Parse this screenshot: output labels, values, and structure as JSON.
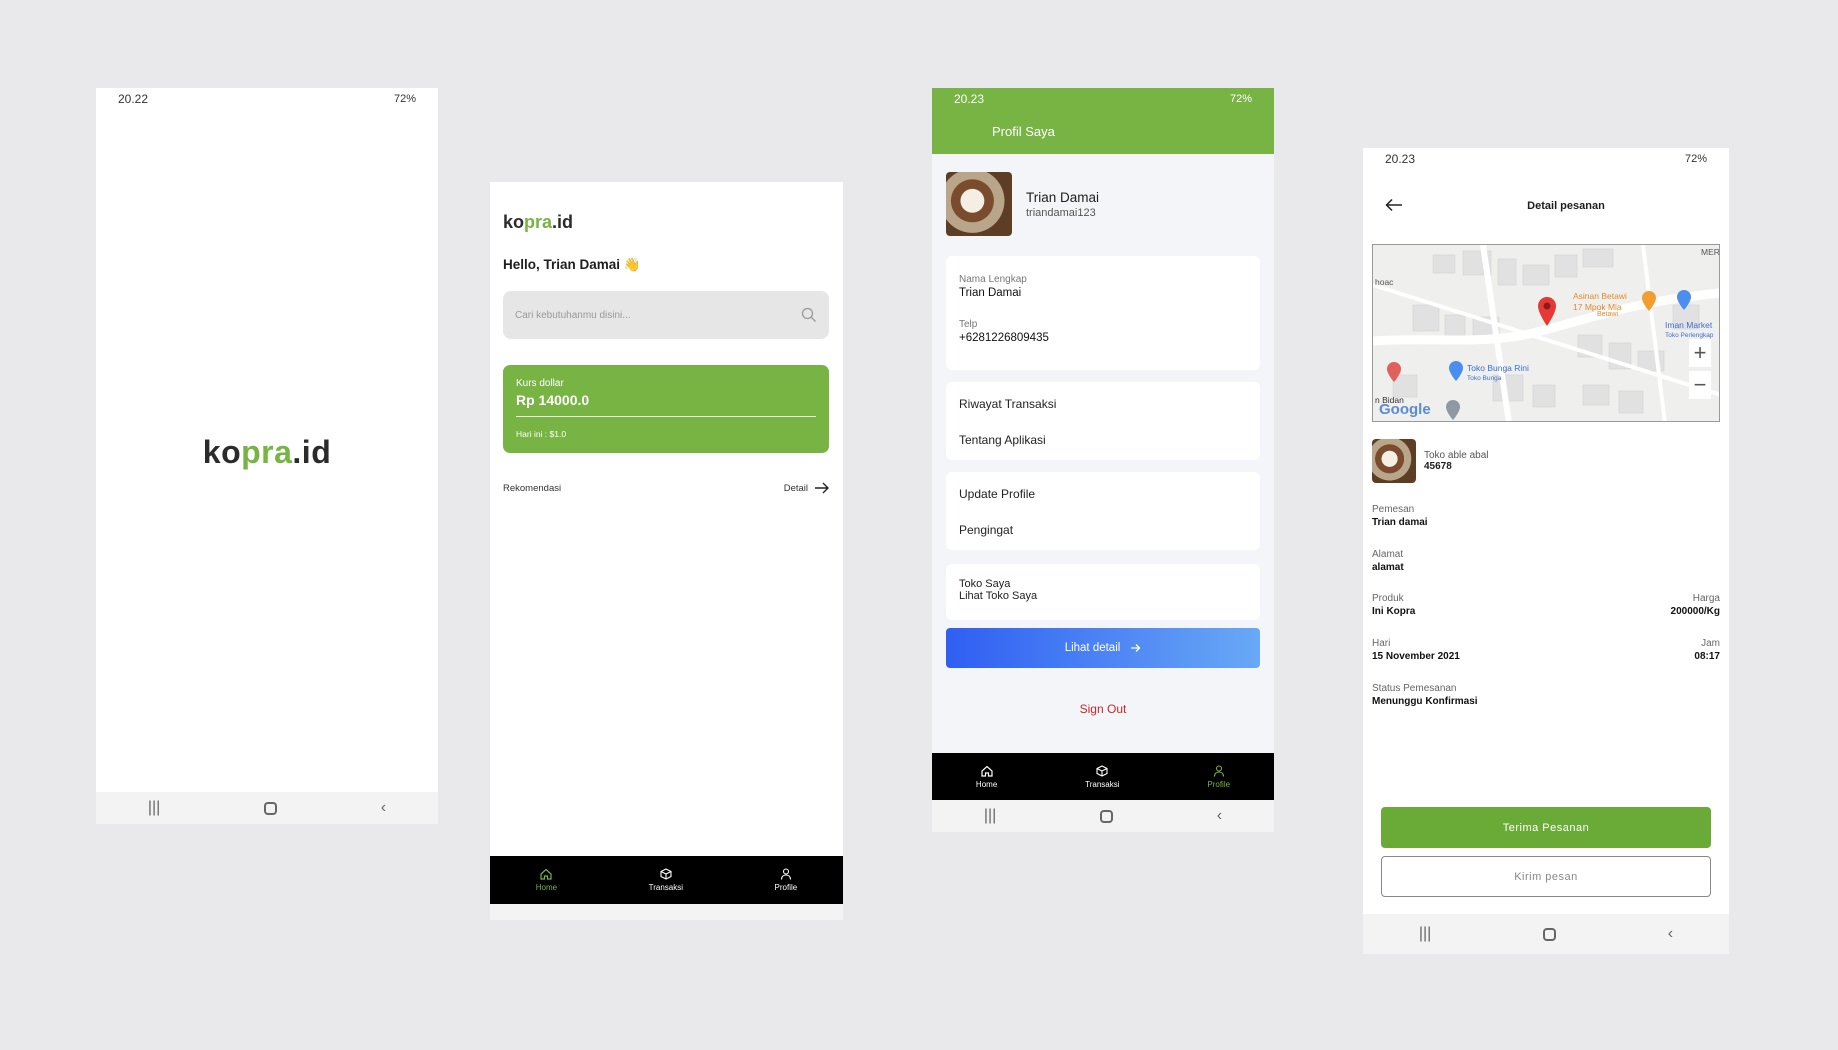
{
  "brand": {
    "logo_ko": "ko",
    "logo_pra": "pra",
    "logo_id": ".id",
    "green": "#78b443"
  },
  "splash": {
    "status_time": "20.22",
    "status_right": "72%"
  },
  "home": {
    "status_time": "",
    "greeting": "Hello, Trian Damai 👋",
    "search_placeholder": "Cari kebutuhanmu disini...",
    "kurs_label": "Kurs dollar",
    "kurs_value": "Rp 14000.0",
    "kurs_today": "Hari ini : $1.0",
    "rekomendasi": "Rekomendasi",
    "detail": "Detail"
  },
  "bottom_nav": [
    {
      "label": "Home",
      "icon": "home-icon"
    },
    {
      "label": "Transaksi",
      "icon": "box-icon"
    },
    {
      "label": "Profile",
      "icon": "user-icon"
    }
  ],
  "profile": {
    "status_time": "20.23",
    "status_right": "72%",
    "title": "Profil Saya",
    "name": "Trian Damai",
    "username": "triandamai123",
    "nama_label": "Nama Lengkap",
    "nama_value": "Trian Damai",
    "telp_label": "Telp",
    "telp_value": "+6281226809435",
    "riwayat": "Riwayat Transaksi",
    "tentang": "Tentang Aplikasi",
    "update": "Update Profile",
    "pengingat": "Pengingat",
    "toko_saya": "Toko Saya",
    "lihat_toko": "Lihat Toko Saya",
    "lihat_detail": "Lihat detail",
    "sign_out": "Sign Out"
  },
  "order": {
    "status_time": "20.23",
    "status_right": "72%",
    "title": "Detail pesanan",
    "map_labels": {
      "asinan": "Asinan Betawi\n17 Mpok Mia",
      "betawi": "Betawi",
      "iman": "Iman Market",
      "toko_perlengkapan": "Toko Perlengkap",
      "toko_bunga": "Toko Bunga Rini",
      "toko_bunga_sub": "Toko Bunga",
      "bidan": "n Bidan",
      "google": "Google",
      "mer": "MER",
      "hoac": "hoac"
    },
    "store_name": "Toko able abal",
    "store_id": "45678",
    "pemesan_label": "Pemesan",
    "pemesan_value": "Trian damai",
    "alamat_label": "Alamat",
    "alamat_value": "alamat",
    "produk_label": "Produk",
    "produk_value": "Ini Kopra",
    "harga_label": "Harga",
    "harga_value": "200000/Kg",
    "hari_label": "Hari",
    "hari_value": "15 November 2021",
    "jam_label": "Jam",
    "jam_value": "08:17",
    "status_label": "Status Pemesanan",
    "status_value": "Menunggu Konfirmasi",
    "terima": "Terima Pesanan",
    "kirim": "Kirim pesan"
  }
}
